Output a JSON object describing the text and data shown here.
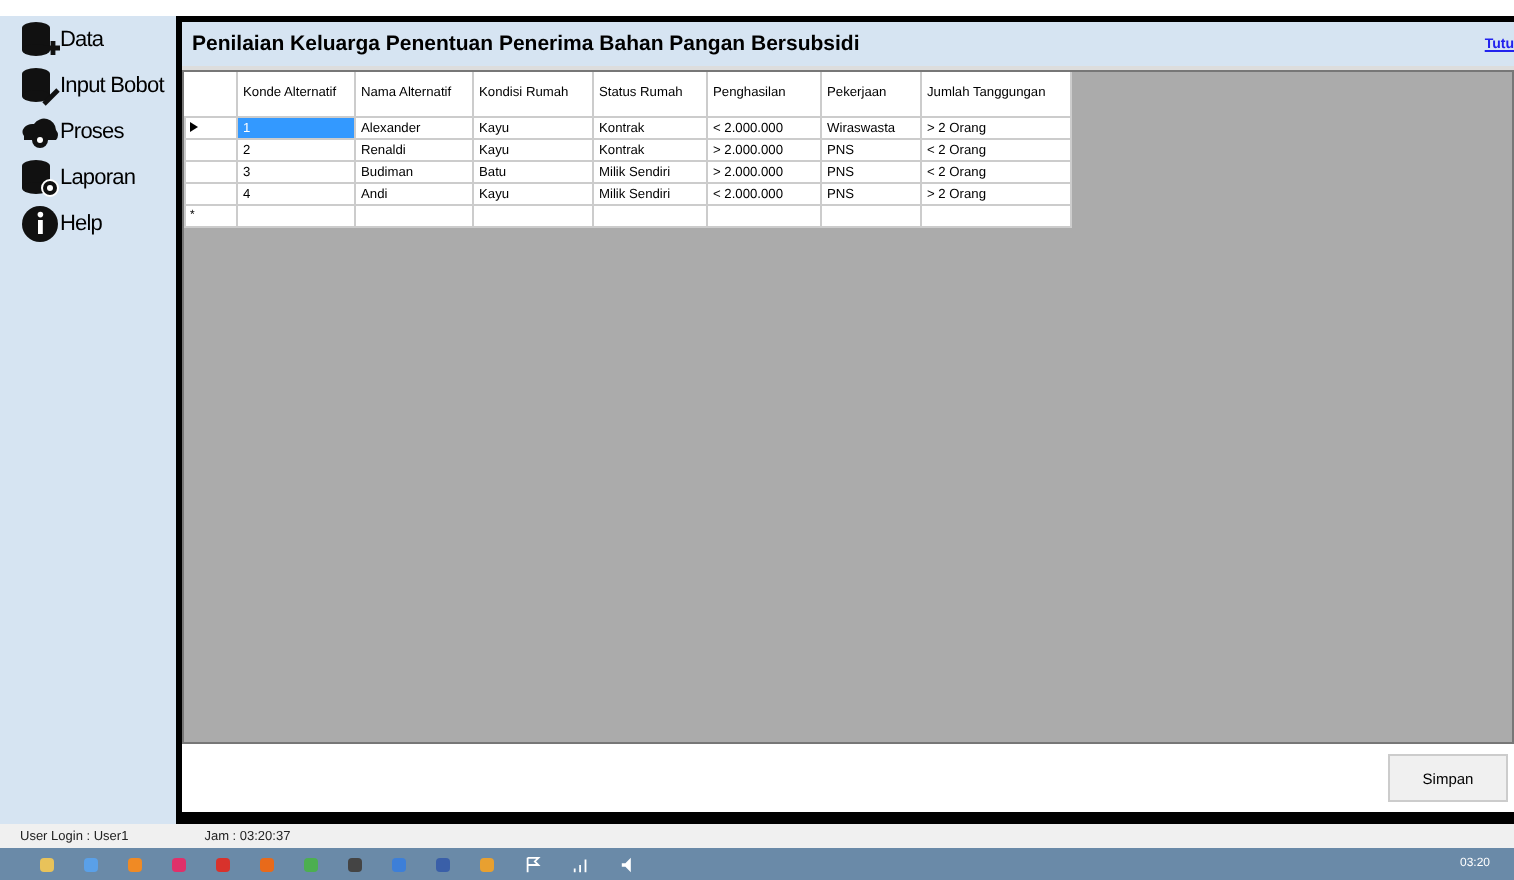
{
  "sidebar": {
    "items": [
      {
        "label": "Data"
      },
      {
        "label": "Input Bobot"
      },
      {
        "label": "Proses"
      },
      {
        "label": "Laporan"
      },
      {
        "label": "Help"
      }
    ]
  },
  "header": {
    "title": "Penilaian Keluarga Penentuan Penerima Bahan Pangan Bersubsidi",
    "link": "Tutu"
  },
  "table": {
    "columns": [
      "Konde Alternatif",
      "Nama Alternatif",
      "Kondisi Rumah",
      "Status Rumah",
      "Penghasilan",
      "Pekerjaan",
      "Jumlah Tanggungan"
    ],
    "rows": [
      {
        "selected": true,
        "cells": [
          "1",
          "Alexander",
          "Kayu",
          "Kontrak",
          "< 2.000.000",
          "Wiraswasta",
          "> 2 Orang"
        ]
      },
      {
        "selected": false,
        "cells": [
          "2",
          "Renaldi",
          "Kayu",
          "Kontrak",
          "> 2.000.000",
          "PNS",
          "< 2 Orang"
        ]
      },
      {
        "selected": false,
        "cells": [
          "3",
          "Budiman",
          "Batu",
          "Milik Sendiri",
          "> 2.000.000",
          "PNS",
          "< 2 Orang"
        ]
      },
      {
        "selected": false,
        "cells": [
          "4",
          "Andi",
          "Kayu",
          "Milik Sendiri",
          "< 2.000.000",
          "PNS",
          "> 2 Orang"
        ]
      }
    ],
    "new_row_marker": "*"
  },
  "save_button": "Simpan",
  "status_bar": {
    "user": "User Login :  User1",
    "time": "Jam :  03:20:37"
  },
  "taskbar": {
    "clock": "03:20"
  }
}
